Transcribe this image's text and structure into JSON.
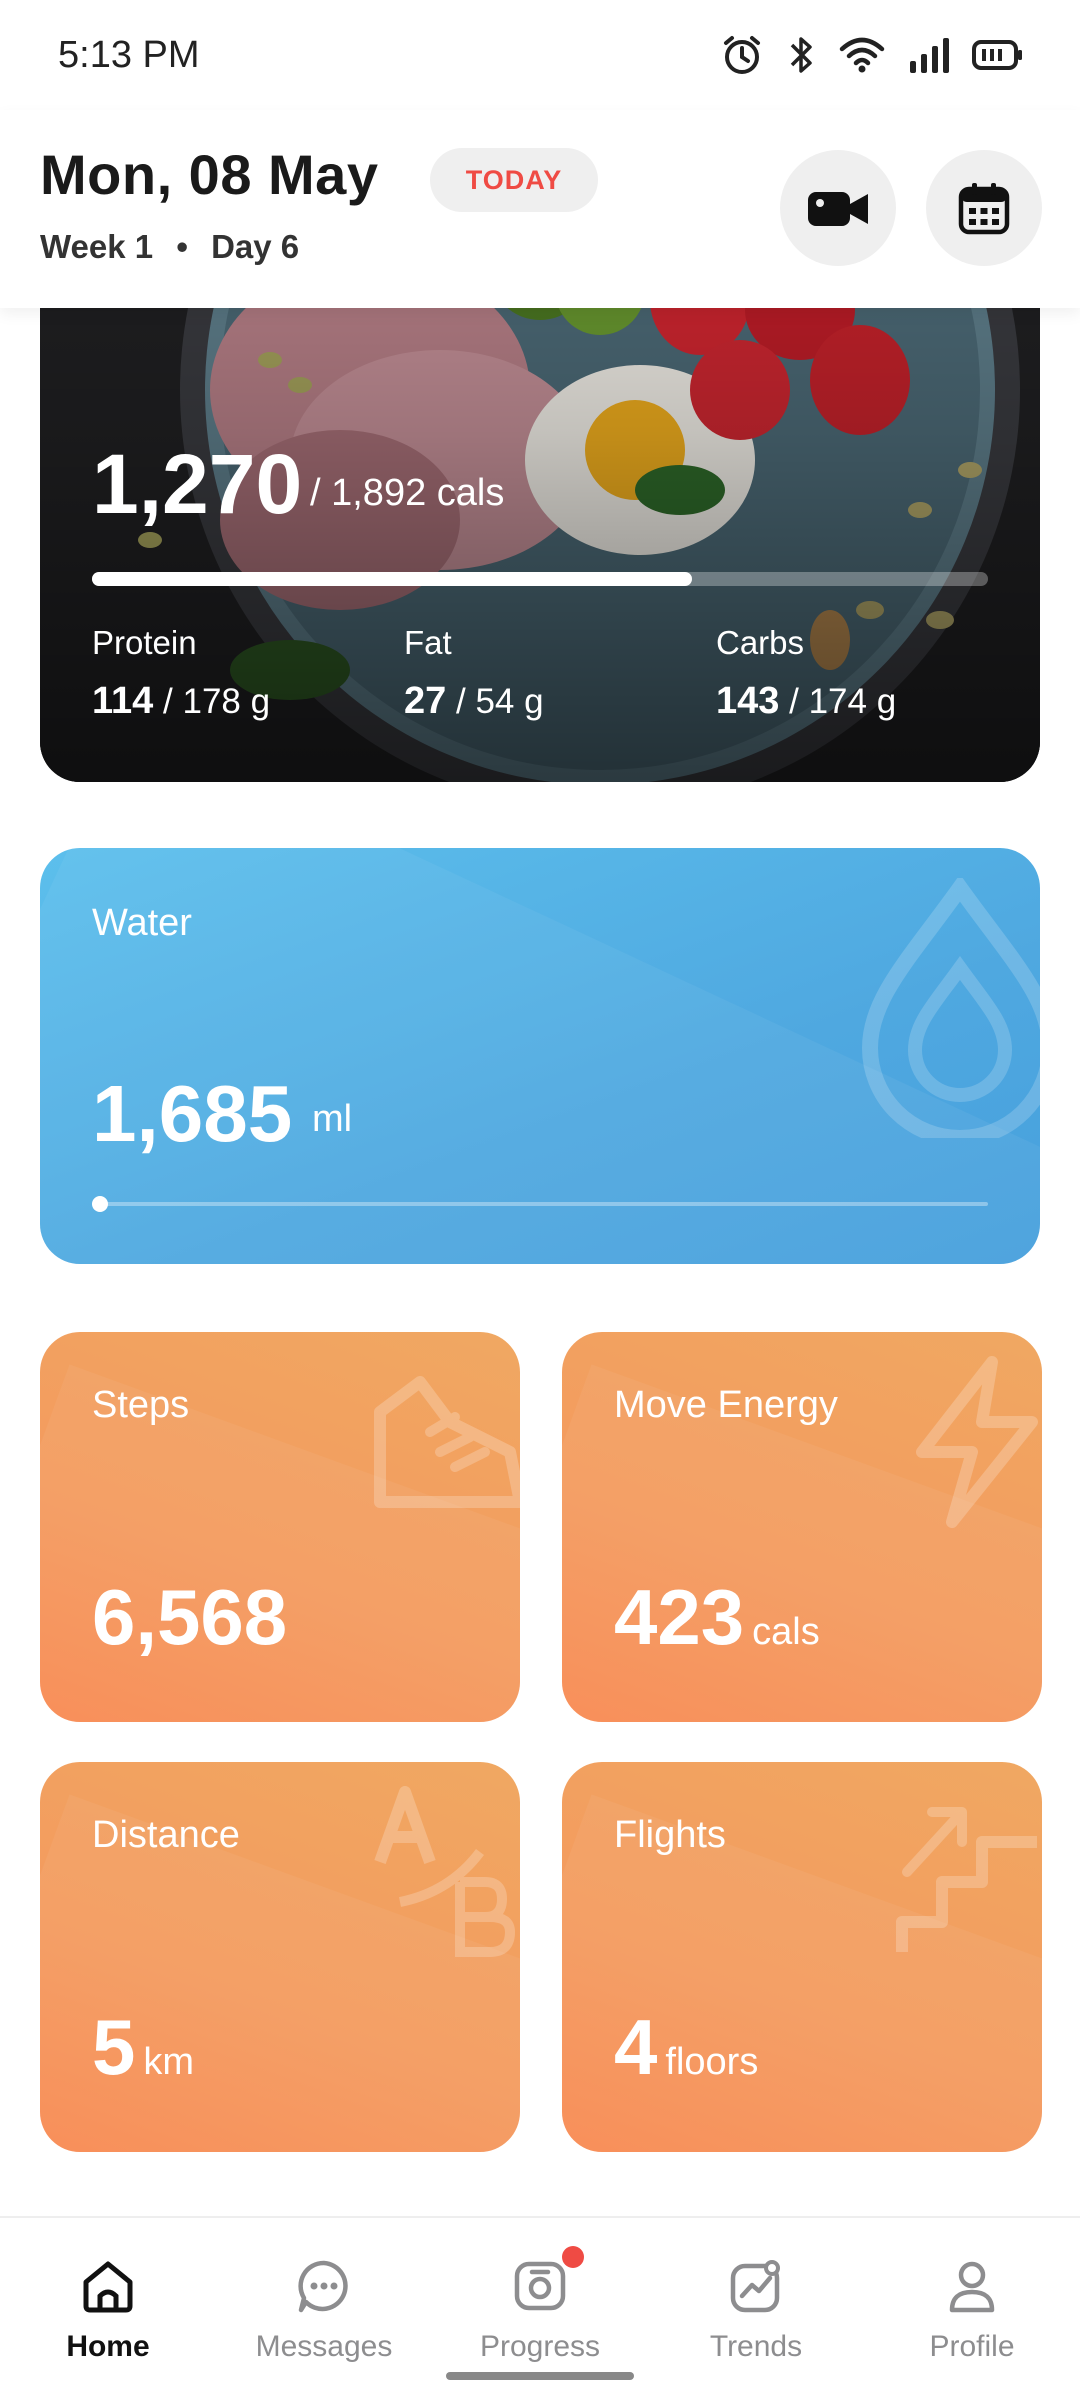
{
  "status_bar": {
    "time": "5:13 PM"
  },
  "header": {
    "date": "Mon, 08 May",
    "today_badge": "TODAY",
    "week_label": "Week",
    "week_number": "1",
    "separator": "•",
    "day_label": "Day",
    "day_number": "6"
  },
  "calories": {
    "consumed": "1,270",
    "goal_text": "/ 1,892 cals",
    "progress": 0.67,
    "macros": [
      {
        "label": "Protein",
        "value": "114",
        "goal": "/ 178 g"
      },
      {
        "label": "Fat",
        "value": "27",
        "goal": "/ 54 g"
      },
      {
        "label": "Carbs",
        "value": "143",
        "goal": "/ 174 g"
      }
    ]
  },
  "water": {
    "label": "Water",
    "value": "1,685",
    "unit": "ml"
  },
  "tiles": {
    "steps": {
      "label": "Steps",
      "value": "6,568",
      "unit": ""
    },
    "move": {
      "label": "Move Energy",
      "value": "423",
      "unit": "cals"
    },
    "distance": {
      "label": "Distance",
      "value": "5",
      "unit": "km"
    },
    "flights": {
      "label": "Flights",
      "value": "4",
      "unit": "floors"
    }
  },
  "nav": [
    {
      "label": "Home",
      "icon": "home-icon",
      "active": true
    },
    {
      "label": "Messages",
      "icon": "chat-icon",
      "active": false
    },
    {
      "label": "Progress",
      "icon": "camera-icon",
      "active": false,
      "badge": true
    },
    {
      "label": "Trends",
      "icon": "trend-icon",
      "active": false
    },
    {
      "label": "Profile",
      "icon": "person-icon",
      "active": false
    }
  ],
  "colors": {
    "accent_red": "#ef4b44",
    "water_blue": "#4fa8e0",
    "tile_orange": "#f49a5e"
  }
}
